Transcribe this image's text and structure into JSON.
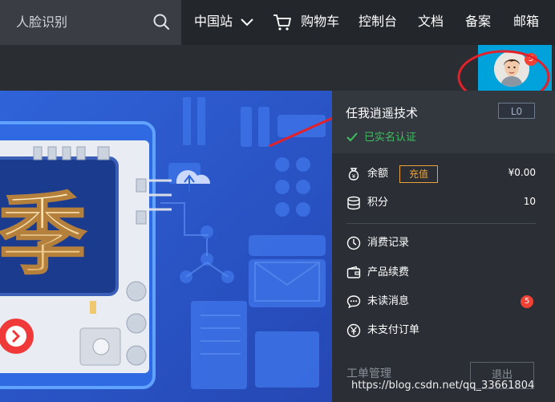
{
  "topnav": {
    "search_placeholder": "人脸识别",
    "items": [
      "中国站",
      "购物车",
      "控制台",
      "文档",
      "备案",
      "邮箱"
    ]
  },
  "banner": {
    "big_char": "季"
  },
  "avatar": {
    "badge_count": "5"
  },
  "user_panel": {
    "username": "任我逍遥技术",
    "level": "L0",
    "verified_text": "已实名认证",
    "balance_label": "余额",
    "recharge_label": "充值",
    "balance_value": "¥0.00",
    "points_label": "积分",
    "points_value": "10",
    "menu": {
      "consumption": "消费记录",
      "renewal": "产品续费",
      "unread": "未读消息",
      "unread_count": "5",
      "unpaid": "未支付订单"
    },
    "ticket_label": "工单管理",
    "logout_label": "退出"
  },
  "watermark": "https://blog.csdn.net/qq_33661804",
  "colors": {
    "accent_blue": "#00a2dc",
    "success_green": "#3fbf5f",
    "warning_orange": "#e8a23a",
    "badge_red": "#f04134",
    "annotation_red": "#e3212a"
  },
  "icons": {
    "search": "search-icon",
    "chevron": "chevron-down-icon",
    "cart": "cart-icon",
    "check": "check-icon",
    "money_bag": "money-bag-icon",
    "coins": "coins-icon",
    "clock": "clock-icon",
    "wallet": "wallet-icon",
    "chat": "chat-bubble-icon",
    "yen": "yen-icon"
  }
}
